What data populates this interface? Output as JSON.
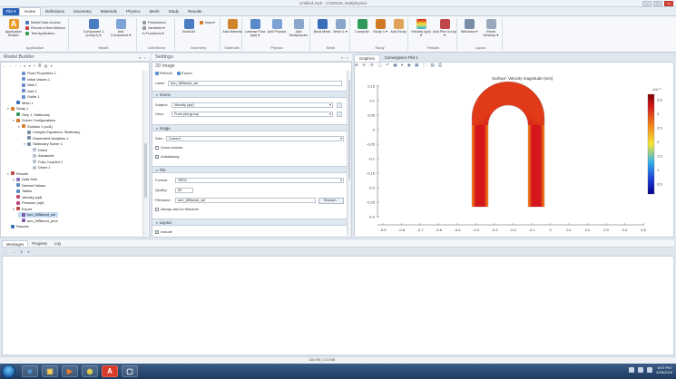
{
  "window": {
    "title": "Untitled.mph - COMSOL Multiphysics"
  },
  "menu": {
    "file": "File ▾",
    "tabs": [
      "Home",
      "Definitions",
      "Geometry",
      "Materials",
      "Physics",
      "Mesh",
      "Study",
      "Results"
    ]
  },
  "ribbon": {
    "groups": [
      {
        "label": "Application"
      },
      {
        "label": "Model"
      },
      {
        "label": "Definitions"
      },
      {
        "label": "Geometry"
      },
      {
        "label": "Materials"
      },
      {
        "label": "Physics"
      },
      {
        "label": "Mesh"
      },
      {
        "label": "Study"
      },
      {
        "label": "Results"
      },
      {
        "label": "Layout"
      }
    ],
    "app_builder": "Application Builder",
    "app_list": [
      "Model Data Access",
      "Record a New Method",
      "Test Application"
    ],
    "component": "Component 1 (comp1) ▾",
    "add_component": "Add Component ▾",
    "params_list": [
      "Parameters",
      "Variables ▾",
      "fx Functions ▾"
    ],
    "build_all": "Build All",
    "import": "Import",
    "add_material": "Add Material",
    "laminar": "Laminar Flow (spf) ▾",
    "add_physics": "Add Physics",
    "add_multiphysics": "Add Multiphysics",
    "build_mesh": "Build Mesh",
    "mesh1": "Mesh 1 ▾",
    "compute": "Compute",
    "study1": "Study 1 ▾",
    "add_study": "Add Study",
    "velocity": "Velocity (spf) ▾",
    "add_plot": "Add Plot Group ▾",
    "windows": "Windows ▾",
    "reset": "Reset Desktop ▾"
  },
  "model_builder": {
    "title": "Model Builder",
    "toolbar_icons": "← → ↑ ↓ ▸ ▾ ≡ ≣ ▤ ▾",
    "tree": [
      {
        "label": "Fixed Properties 1",
        "level": 3,
        "icon": "#6a8fd0"
      },
      {
        "label": "Initial Values 1",
        "level": 3,
        "icon": "#6a8fd0"
      },
      {
        "label": "Wall 1",
        "level": 3,
        "icon": "#6a8fd0"
      },
      {
        "label": "Inlet 1",
        "level": 3,
        "icon": "#6a8fd0"
      },
      {
        "label": "Outlet 1",
        "level": 3,
        "icon": "#6a8fd0"
      },
      {
        "label": "Mesh 1",
        "level": 2,
        "icon": "#3a6fb8"
      },
      {
        "label": "Study 1",
        "level": 1,
        "icon": "#d07a2a",
        "arrow": "▾"
      },
      {
        "label": "Step 1: Stationary",
        "level": 2,
        "icon": "#2f9a5a"
      },
      {
        "label": "Solver Configurations",
        "level": 2,
        "icon": "#d07a2a",
        "arrow": "▾"
      },
      {
        "label": "Solution 1 (sol1)",
        "level": 3,
        "icon": "#d07a2a",
        "arrow": "▾"
      },
      {
        "label": "Compile Equations: Stationary",
        "level": 4,
        "icon": "#7b8ea8"
      },
      {
        "label": "Dependent Variables 1",
        "level": 4,
        "icon": "#7b8ea8"
      },
      {
        "label": "Stationary Solver 1",
        "level": 4,
        "icon": "#7b8ea8",
        "arrow": "▾"
      },
      {
        "label": "Direct",
        "level": 5,
        "icon": "#b8c2cf"
      },
      {
        "label": "Advanced",
        "level": 5,
        "icon": "#b8c2cf"
      },
      {
        "label": "Fully Coupled 1",
        "level": 5,
        "icon": "#b8c2cf"
      },
      {
        "label": "Direct 1",
        "level": 5,
        "icon": "#b8c2cf"
      },
      {
        "label": "Results",
        "level": 1,
        "icon": "#c04848",
        "arrow": "▾"
      },
      {
        "label": "Data Sets",
        "level": 2,
        "icon": "#8a6fc0",
        "arrow": "▸"
      },
      {
        "label": "Derived Values",
        "level": 2,
        "icon": "#5a8ac8"
      },
      {
        "label": "Tables",
        "level": 2,
        "icon": "#5a8ac8"
      },
      {
        "label": "Velocity (spf)",
        "level": 2,
        "icon": "#c04878"
      },
      {
        "label": "Pressure (spf)",
        "level": 2,
        "icon": "#c04878"
      },
      {
        "label": "Export",
        "level": 2,
        "icon": "#c04848",
        "arrow": "▾"
      },
      {
        "label": "turn_WBtumd_vel",
        "level": 3,
        "icon": "#7b5aa8",
        "selected": true
      },
      {
        "label": "turn_WBtumd_pres",
        "level": 3,
        "icon": "#7b5aa8"
      },
      {
        "label": "Reports",
        "level": 1,
        "icon": "#3a6fb8"
      }
    ]
  },
  "settings": {
    "title": "Settings",
    "subtitle": "2D Image",
    "refresh": "Refresh",
    "export": "Export",
    "label_name": "Label:",
    "label_value": "turn_WBtumd_vel",
    "scene_header": "Scene",
    "subject_name": "Subject:",
    "subject_value": "Velocity (spf)",
    "view_name": "View:",
    "view_value": "From plot group",
    "image_header": "Image",
    "size_name": "Size:",
    "size_value": "Current",
    "zoom_extents": "Zoom extents",
    "antialiasing": "Antialiasing",
    "file_header": "File",
    "format_name": "Format:",
    "format_value": "JPEG",
    "quality_name": "Quality:",
    "quality_value": "92",
    "filename_name": "Filename:",
    "filename_value": "turn_WBtumd_vel",
    "browse": "Browse...",
    "always_ask": "Always ask for filename",
    "layout_header": "Layout",
    "include": "Include"
  },
  "graphics": {
    "tabs": [
      "Graphics",
      "Convergence Plot 1"
    ],
    "toolbar_icons": "⊕ ⊖ ⦿ ▢ ↶ ▣ ▾ ◉ ▦ ⬚ ▤ ⎙",
    "plot_title": "Surface: Velocity magnitude (m/s)",
    "y_ticks": [
      "0.15",
      "0.1",
      "0.05",
      "0",
      "-0.05",
      "-0.1",
      "-0.15",
      "-0.2",
      "-0.25",
      "-0.3"
    ],
    "x_ticks": [
      "-0.9",
      "-0.8",
      "-0.7",
      "-0.6",
      "-0.5",
      "-0.4",
      "-0.3",
      "-0.2",
      "-0.1",
      "0",
      "0.1",
      "0.2",
      "0.3",
      "0.4",
      "0.5"
    ],
    "colorbar_unit": "x10⁻³",
    "colorbar_ticks": [
      "3.5",
      "3",
      "2.5",
      "2",
      "1.5",
      "1",
      "0.5"
    ],
    "colors": {
      "hot": "#d4171b",
      "warm": "#f28a1a",
      "mid": "#f6e63a",
      "cool": "#33b0e8",
      "cold": "#00008f"
    }
  },
  "messages": {
    "tabs": [
      "Messages",
      "Progress",
      "Log"
    ],
    "toolbar_icons": "⬚ ↔ ⬇ ▾"
  },
  "status": {
    "memory": "146 MB | 213 MB"
  },
  "taskbar": {
    "apps": [
      "e",
      "▣",
      "▶",
      "◉",
      "A",
      "▢"
    ],
    "time": "8:07 PM",
    "date": "4/26/2018"
  }
}
